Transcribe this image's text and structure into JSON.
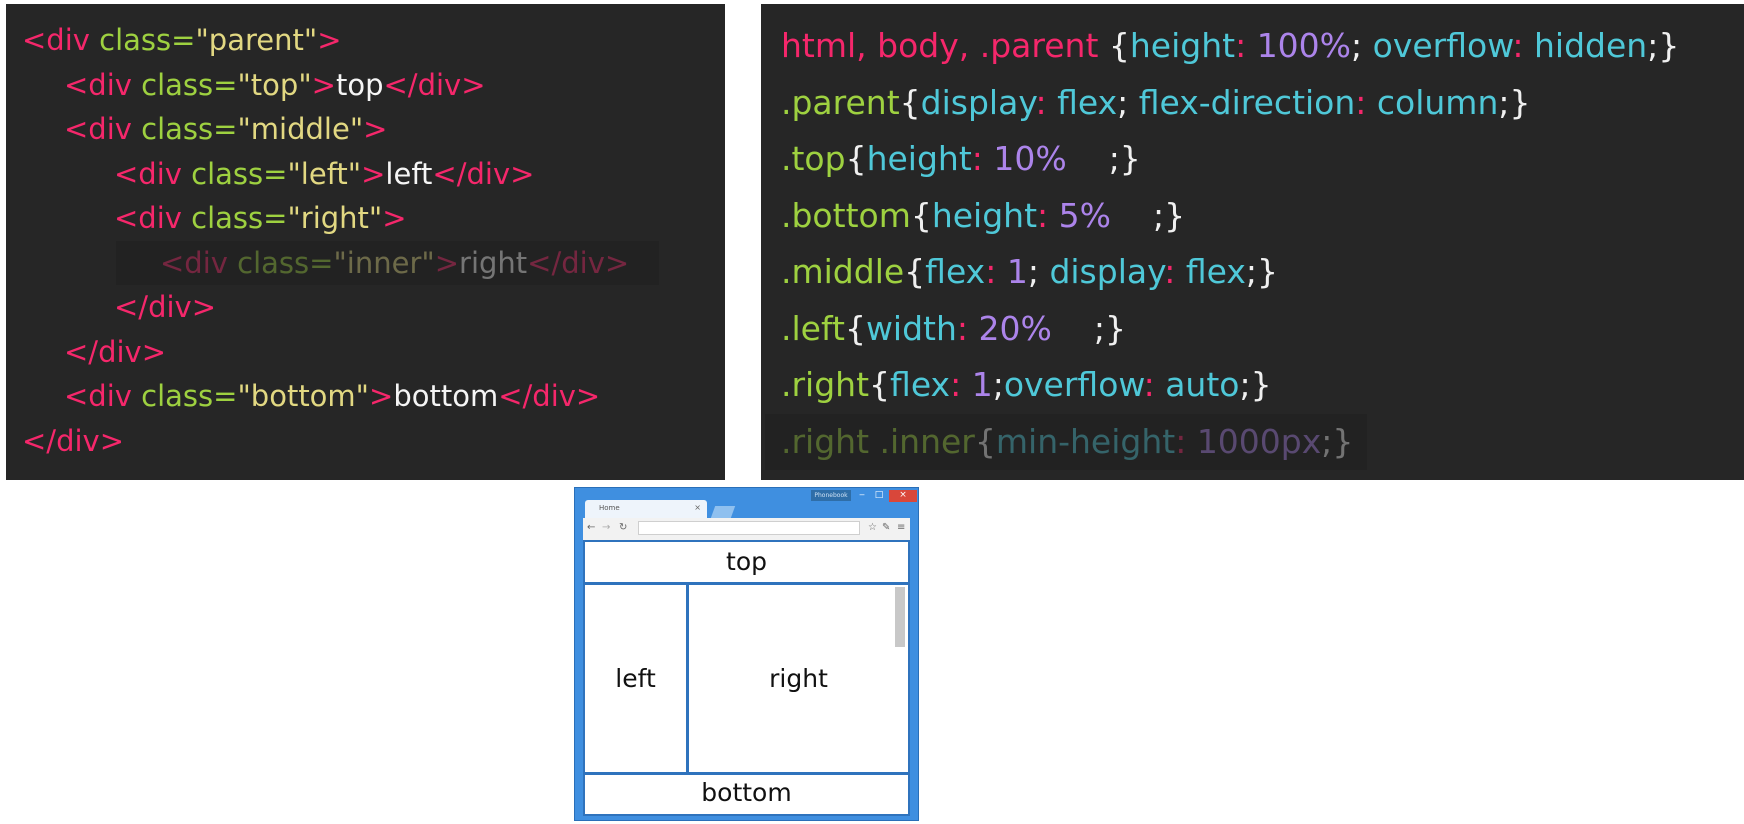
{
  "html_code": {
    "l1": {
      "lt": "<div",
      "attr": " class=",
      "val": "\"parent\"",
      "gt": ">"
    },
    "l2": {
      "lt": "<div",
      "attr": " class=",
      "val": "\"top\"",
      "gt": ">",
      "text": "top",
      "close": "</div>"
    },
    "l3": {
      "lt": "<div",
      "attr": " class=",
      "val": "\"middle\"",
      "gt": ">"
    },
    "l4": {
      "lt": "<div",
      "attr": " class=",
      "val": "\"left\"",
      "gt": ">",
      "text": "left",
      "close": "</div>"
    },
    "l5": {
      "lt": "<div",
      "attr": " class=",
      "val": "\"right\"",
      "gt": ">"
    },
    "l6": {
      "lt": "<div",
      "attr": " class=",
      "val": "\"inner\"",
      "gt": ">",
      "text": "right",
      "close": "</div>"
    },
    "l7": {
      "close": "</div>"
    },
    "l8": {
      "close": "</div>"
    },
    "l9": {
      "lt": "<div",
      "attr": " class=",
      "val": "\"bottom\"",
      "gt": ">",
      "text": "bottom",
      "close": "</div>"
    },
    "l10": {
      "close": "</div>"
    }
  },
  "css_code": {
    "c1": {
      "sel": "html, body, .parent ",
      "ob": "{",
      "p1": "height",
      "c1": ": ",
      "v1": "100%",
      "s1": "; ",
      "p2": "overflow",
      "c2": ": ",
      "v2": "hidden",
      "cb": ";}"
    },
    "c2": {
      "sel": ".parent",
      "ob": "{",
      "p1": "display",
      "c1": ": ",
      "v1": "flex",
      "s1": "; ",
      "p2": "flex-direction",
      "c2": ": ",
      "v2": "column",
      "cb": ";}"
    },
    "c3": {
      "sel": ".top",
      "ob": "{",
      "p1": "height",
      "c1": ": ",
      "v1": "10%",
      "cb": "    ;}"
    },
    "c4": {
      "sel": ".bottom",
      "ob": "{",
      "p1": "height",
      "c1": ": ",
      "v1": "5%",
      "cb": "    ;}"
    },
    "c5": {
      "sel": ".middle",
      "ob": "{",
      "p1": "flex",
      "c1": ": ",
      "v1": "1",
      "s1": "; ",
      "p2": "display",
      "c2": ": ",
      "v2": "flex",
      "cb": ";}"
    },
    "c6": {
      "sel": ".left",
      "ob": "{",
      "p1": "width",
      "c1": ": ",
      "v1": "20%",
      "cb": "    ;}"
    },
    "c7": {
      "sel": ".right",
      "ob": "{",
      "p1": "flex",
      "c1": ": ",
      "v1": "1",
      "s1": ";",
      "p2": "overflow",
      "c2": ": ",
      "v2": "auto",
      "cb": ";}"
    },
    "c8": {
      "sel": ".right .inner",
      "ob": "{",
      "p1": "min-height",
      "c1": ": ",
      "v1": "1000px",
      "cb": ";}"
    }
  },
  "browser": {
    "tab_title": "Home",
    "tab_close": "×",
    "window_label": "Phonebook",
    "min": "‒",
    "max": "□",
    "close": "×",
    "back": "←",
    "forward": "→",
    "reload": "↻",
    "menu": "≡"
  },
  "demo": {
    "top": "top",
    "left": "left",
    "right": "right",
    "bottom": "bottom"
  }
}
